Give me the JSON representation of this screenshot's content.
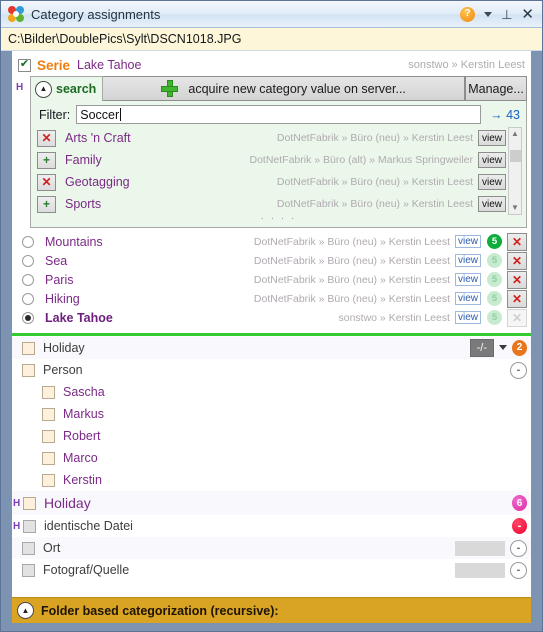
{
  "window": {
    "title": "Category assignments",
    "logo_icon": "color-wheel-icon",
    "help_icon": "help-icon",
    "help_label": "?",
    "dropdown_icon": "chevron-down-icon",
    "pin_icon": "pin-icon",
    "pin_glyph": "⊥",
    "close_icon": "close-icon",
    "close_glyph": "✕"
  },
  "path_bar": {
    "value": "C:\\Bilder\\DoublePics\\Sylt\\DSCN1018.JPG"
  },
  "serie": {
    "checkbox_checked": true,
    "label": "Serie",
    "value": "Lake Tahoe",
    "owner": "sonstwo » Kerstin Leest"
  },
  "search_panel": {
    "h_marker": "H",
    "collapse_icon": "chevron-up-circle-icon",
    "tab_label": "search",
    "acquire_button": "acquire new category value on server...",
    "acquire_icon": "plus-icon",
    "manage_button": "Manage...",
    "filter_label": "Filter:",
    "filter_value": "Soccer",
    "filter_count": "→ 43",
    "scrollbar_up_icon": "chevron-up-icon",
    "scrollbar_down_icon": "chevron-down-icon",
    "results": [
      {
        "action": "x",
        "action_icon": "remove-icon",
        "name": "Arts 'n Craft",
        "path": "DotNetFabrik » Büro (neu) » Kerstin Leest",
        "view": "view"
      },
      {
        "action": "plus",
        "action_icon": "add-icon",
        "name": "Family",
        "path": "DotNetFabrik » Büro (alt) » Markus Springweiler",
        "view": "view"
      },
      {
        "action": "x",
        "action_icon": "remove-icon",
        "name": "Geotagging",
        "path": "DotNetFabrik » Büro (neu) » Kerstin Leest",
        "view": "view"
      },
      {
        "action": "plus",
        "action_icon": "add-icon",
        "name": "Sports",
        "path": "DotNetFabrik » Büro (neu) » Kerstin Leest",
        "view": "view"
      }
    ],
    "dots": "· · · ·"
  },
  "selection_list": [
    {
      "selected": false,
      "name": "Mountains",
      "path": "DotNetFabrik » Büro (neu) » Kerstin Leest",
      "view": "view",
      "count": "5",
      "count_active": true,
      "remove_icon": "remove-icon",
      "remove_glyph": "✕",
      "remove_enabled": true
    },
    {
      "selected": false,
      "name": "Sea",
      "path": "DotNetFabrik » Büro (neu) » Kerstin Leest",
      "view": "view",
      "count": "5",
      "count_active": false,
      "remove_icon": "remove-icon",
      "remove_glyph": "✕",
      "remove_enabled": true
    },
    {
      "selected": false,
      "name": "Paris",
      "path": "DotNetFabrik » Büro (neu) » Kerstin Leest",
      "view": "view",
      "count": "5",
      "count_active": false,
      "remove_icon": "remove-icon",
      "remove_glyph": "✕",
      "remove_enabled": true
    },
    {
      "selected": false,
      "name": "Hiking",
      "path": "DotNetFabrik » Büro (neu) » Kerstin Leest",
      "view": "view",
      "count": "5",
      "count_active": false,
      "remove_icon": "remove-icon",
      "remove_glyph": "✕",
      "remove_enabled": true
    },
    {
      "selected": true,
      "name": "Lake Tahoe",
      "path": "sonstwo » Kerstin Leest",
      "view": "view",
      "count": "5",
      "count_active": false,
      "remove_icon": "remove-icon",
      "remove_glyph": "✕",
      "remove_enabled": false
    }
  ],
  "tree": [
    {
      "id": "holiday-top",
      "label": "Holiday",
      "indent": 0,
      "style": "normal",
      "box": "cream",
      "alt": true,
      "h": "",
      "select_value": "-/-",
      "badge": "2",
      "badge_kind": "orange",
      "field": false
    },
    {
      "id": "person",
      "label": "Person",
      "indent": 0,
      "style": "normal",
      "box": "cream",
      "alt": false,
      "h": "",
      "badge": "-",
      "badge_kind": "hollow",
      "field": false
    },
    {
      "id": "sascha",
      "label": "Sascha",
      "indent": 1,
      "style": "purple",
      "box": "cream",
      "alt": false,
      "h": "",
      "badge": "",
      "badge_kind": "",
      "field": false
    },
    {
      "id": "markus",
      "label": "Markus",
      "indent": 1,
      "style": "purple",
      "box": "cream",
      "alt": false,
      "h": "",
      "badge": "",
      "badge_kind": "",
      "field": false
    },
    {
      "id": "robert",
      "label": "Robert",
      "indent": 1,
      "style": "purple",
      "box": "cream",
      "alt": false,
      "h": "",
      "badge": "",
      "badge_kind": "",
      "field": false
    },
    {
      "id": "marco",
      "label": "Marco",
      "indent": 1,
      "style": "purple",
      "box": "cream",
      "alt": false,
      "h": "",
      "badge": "",
      "badge_kind": "",
      "field": false
    },
    {
      "id": "kerstin",
      "label": "Kerstin",
      "indent": 1,
      "style": "purple",
      "box": "cream",
      "alt": false,
      "h": "",
      "badge": "",
      "badge_kind": "",
      "field": false
    },
    {
      "id": "holiday-2",
      "label": "Holiday",
      "indent": 0,
      "style": "big",
      "box": "cream",
      "alt": true,
      "h": "H",
      "badge": "6",
      "badge_kind": "magenta",
      "field": false
    },
    {
      "id": "identische-datei",
      "label": "identische Datei",
      "indent": 0,
      "style": "normal",
      "box": "gray",
      "alt": false,
      "h": "H",
      "badge": "-",
      "badge_kind": "red",
      "field": false
    },
    {
      "id": "ort",
      "label": "Ort",
      "indent": 0,
      "style": "normal",
      "box": "gray",
      "alt": true,
      "h": "",
      "badge": "-",
      "badge_kind": "hollow",
      "field": true
    },
    {
      "id": "fotograf-quelle",
      "label": "Fotograf/Quelle",
      "indent": 0,
      "style": "normal",
      "box": "gray",
      "alt": false,
      "h": "",
      "badge": "-",
      "badge_kind": "hollow",
      "field": true
    }
  ],
  "footer": {
    "collapse_icon": "chevron-up-circle-icon",
    "label": "Folder based categorization (recursive):"
  }
}
